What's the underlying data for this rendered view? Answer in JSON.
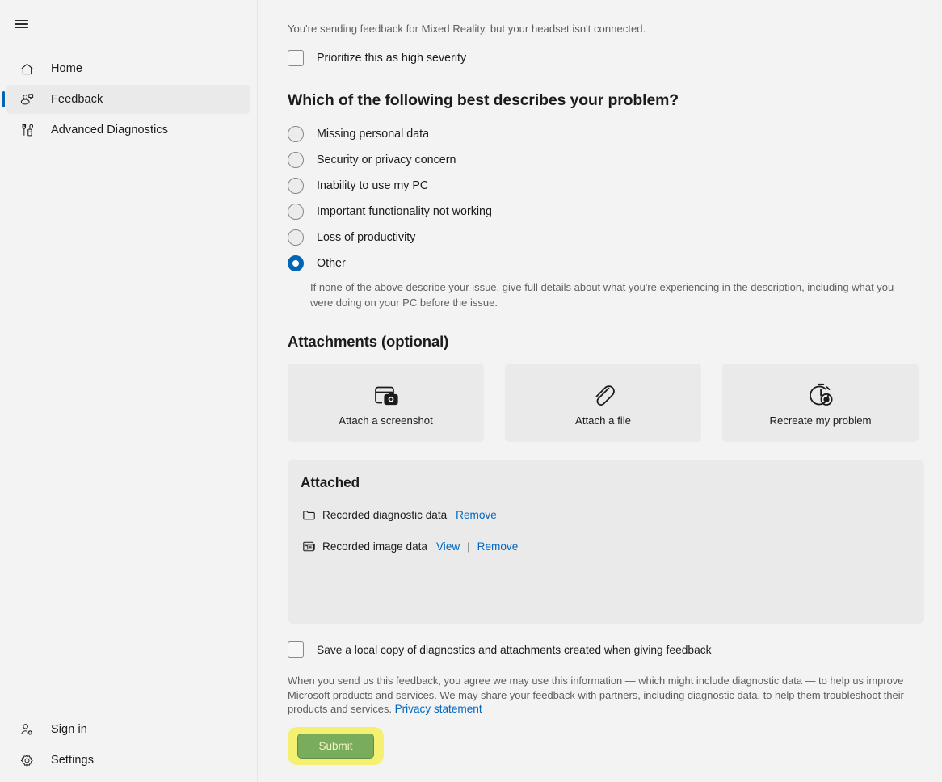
{
  "sidebar": {
    "menu_icon": "hamburger-menu-icon",
    "items": [
      {
        "label": "Home",
        "icon": "home-icon",
        "selected": false
      },
      {
        "label": "Feedback",
        "icon": "feedback-icon",
        "selected": true
      },
      {
        "label": "Advanced Diagnostics",
        "icon": "diagnostics-icon",
        "selected": false
      }
    ],
    "bottom_items": [
      {
        "label": "Sign in",
        "icon": "person-add-icon"
      },
      {
        "label": "Settings",
        "icon": "gear-icon"
      }
    ]
  },
  "main": {
    "notice": "You're sending feedback for Mixed Reality, but your headset isn't connected.",
    "severity": {
      "label": "Prioritize this as high severity",
      "checked": false
    },
    "problem_question": "Which of the following best describes your problem?",
    "problem_options": [
      {
        "label": "Missing personal data",
        "selected": false
      },
      {
        "label": "Security or privacy concern",
        "selected": false
      },
      {
        "label": "Inability to use my PC",
        "selected": false
      },
      {
        "label": "Important functionality not working",
        "selected": false
      },
      {
        "label": "Loss of productivity",
        "selected": false
      },
      {
        "label": "Other",
        "selected": true
      }
    ],
    "other_helper": "If none of the above describe your issue, give full details about what you're experiencing in the description, including what you were doing on your PC before the issue.",
    "attachments_heading": "Attachments (optional)",
    "attachment_cards": [
      {
        "label": "Attach a screenshot",
        "icon": "screenshot-camera-icon"
      },
      {
        "label": "Attach a file",
        "icon": "paperclip-icon"
      },
      {
        "label": "Recreate my problem",
        "icon": "stopwatch-record-icon"
      }
    ],
    "attached": {
      "title": "Attached",
      "rows": [
        {
          "name": "Recorded diagnostic data",
          "icon": "folder-icon",
          "view_label": "",
          "remove_label": "Remove",
          "has_view": false
        },
        {
          "name": "Recorded image data",
          "icon": "image-data-icon",
          "view_label": "View",
          "separator": "|",
          "remove_label": "Remove",
          "has_view": true
        }
      ]
    },
    "save_copy": {
      "label": "Save a local copy of diagnostics and attachments created when giving feedback",
      "checked": false
    },
    "legal_text": "When you send us this feedback, you agree we may use this information — which might include diagnostic data — to help us improve Microsoft products and services. We may share your feedback with partners, including diagnostic data, to help them troubleshoot their products and services. ",
    "privacy_link": "Privacy statement",
    "submit_label": "Submit"
  },
  "colors": {
    "accent": "#0066b4",
    "link": "#0067c0",
    "page_bg": "#f3f3f3",
    "panel_bg": "#eaeaea",
    "submit_bg": "#79ad5c",
    "highlight": "#f5f071"
  }
}
